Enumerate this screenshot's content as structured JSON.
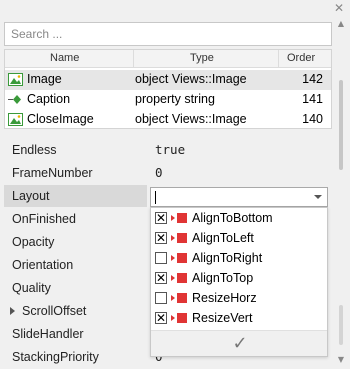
{
  "window": {
    "close_icon": "close-icon"
  },
  "search": {
    "placeholder": "Search ..."
  },
  "grid": {
    "columns": [
      "Name",
      "Type",
      "Order"
    ],
    "rows": [
      {
        "icon": "image-icon",
        "name": "Image",
        "type": "object Views::Image",
        "order": "142"
      },
      {
        "icon": "diamond-icon",
        "name": "Caption",
        "type": "property string",
        "order": "141"
      },
      {
        "icon": "image-icon",
        "name": "CloseImage",
        "type": "object Views::Image",
        "order": "140"
      }
    ]
  },
  "properties": [
    {
      "name": "Endless",
      "value": "true"
    },
    {
      "name": "FrameNumber",
      "value": "0"
    },
    {
      "name": "Layout",
      "value": ""
    },
    {
      "name": "OnFinished",
      "value": ""
    },
    {
      "name": "Opacity",
      "value": ""
    },
    {
      "name": "Orientation",
      "value": ""
    },
    {
      "name": "Quality",
      "value": ""
    },
    {
      "name": "ScrollOffset",
      "value": ""
    },
    {
      "name": "SlideHandler",
      "value": ""
    },
    {
      "name": "StackingPriority",
      "value": "0"
    }
  ],
  "layout_dropdown": {
    "current_value": "",
    "options": [
      {
        "label": "AlignToBottom",
        "checked": true
      },
      {
        "label": "AlignToLeft",
        "checked": true
      },
      {
        "label": "AlignToRight",
        "checked": false
      },
      {
        "label": "AlignToTop",
        "checked": true
      },
      {
        "label": "ResizeHorz",
        "checked": false
      },
      {
        "label": "ResizeVert",
        "checked": true
      }
    ],
    "confirm_icon": "checkmark-icon"
  },
  "colors": {
    "flag_red": "#e03535",
    "image_green": "#3a9a3a",
    "selection": "#d9d9d9"
  }
}
